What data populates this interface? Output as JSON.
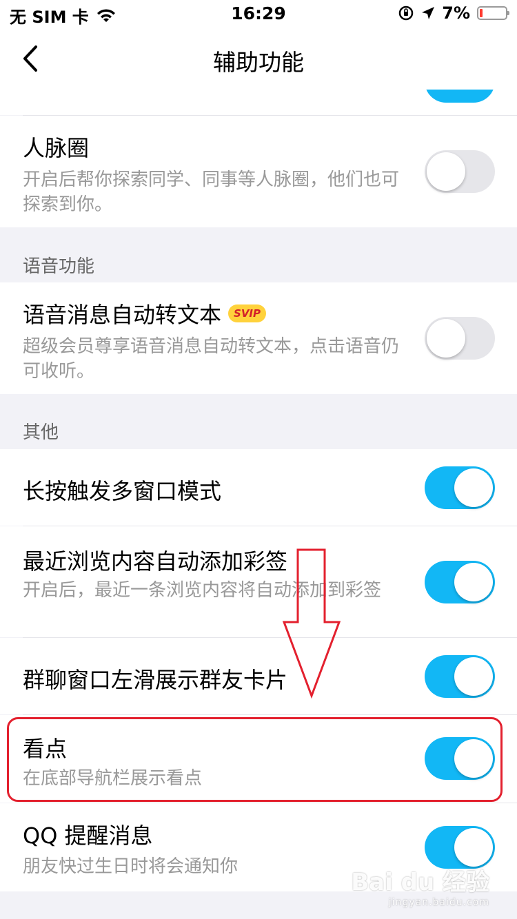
{
  "status_bar": {
    "carrier": "无 SIM 卡",
    "time": "16:29",
    "battery_percent": "7%",
    "battery_level": 0.07,
    "battery_color": "#ff3b30"
  },
  "nav": {
    "title": "辅助功能",
    "back_icon": "chevron-left-icon"
  },
  "accent_color": "#12b7f5",
  "items": {
    "contacts_circle": {
      "title": "人脉圈",
      "desc": "开启后帮你探索同学、同事等人脉圈，他们也可探索到你。",
      "enabled": false
    },
    "voice_to_text": {
      "title": "语音消息自动转文本",
      "badge": "SVIP",
      "desc": "超级会员尊享语音消息自动转文本，点击语音仍可收听。",
      "enabled": false
    },
    "long_press_multiwindow": {
      "title": "长按触发多窗口模式",
      "enabled": true
    },
    "recent_browse_note": {
      "title": "最近浏览内容自动添加彩签",
      "desc": "开启后，最近一条浏览内容将自动添加到彩签",
      "enabled": true
    },
    "group_swipe_card": {
      "title": "群聊窗口左滑展示群友卡片",
      "enabled": true
    },
    "kandian": {
      "title": "看点",
      "desc": "在底部导航栏展示看点",
      "enabled": true
    },
    "qq_reminder": {
      "title": "QQ 提醒消息",
      "desc": "朋友快过生日时将会通知你",
      "enabled": true
    }
  },
  "sections": {
    "voice": "语音功能",
    "other": "其他"
  },
  "annotation_color": "#e3202e",
  "watermark": {
    "main": "Bai du 经验",
    "sub": "jingyan.baidu.com"
  }
}
